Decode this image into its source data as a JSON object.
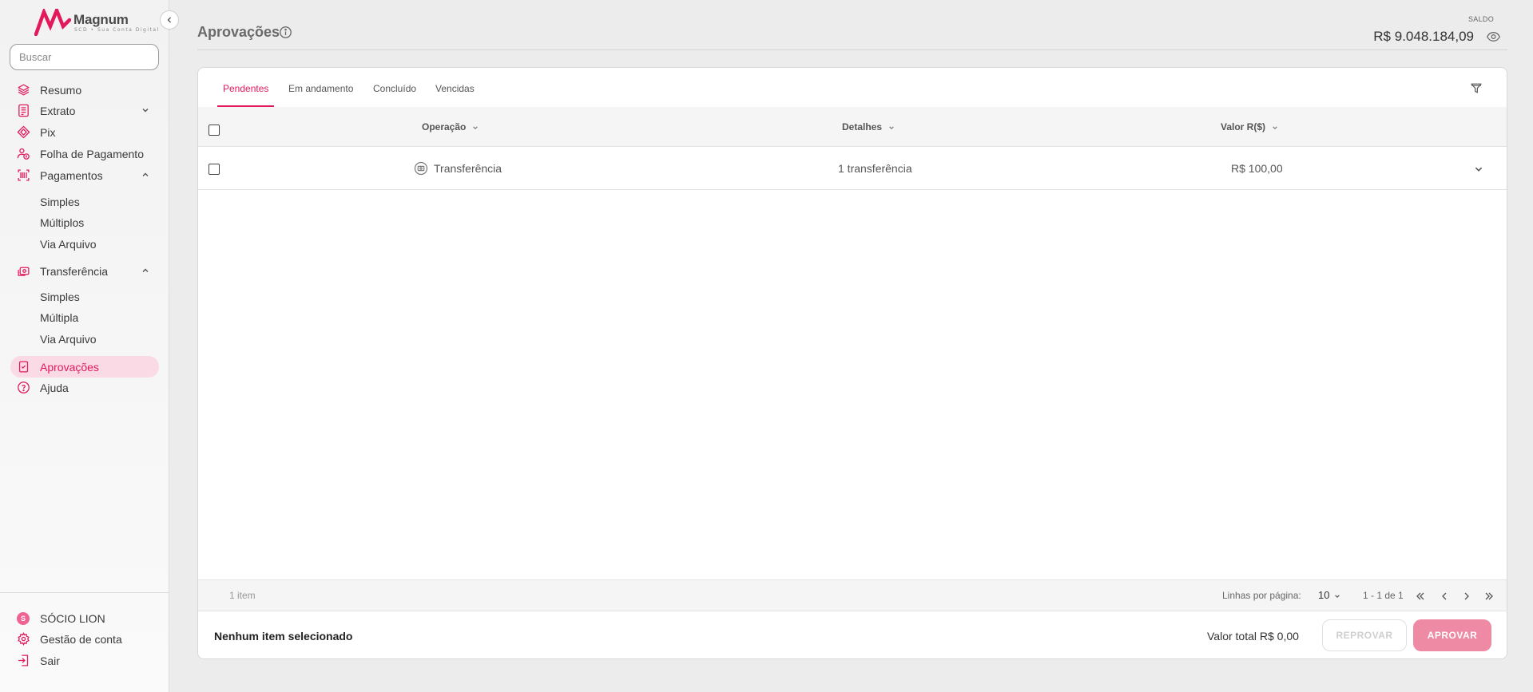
{
  "brand": {
    "name": "Magnum",
    "sub": "SCD • Sua Conta Digital",
    "color": "#e2195b"
  },
  "sidebar": {
    "search_placeholder": "Buscar",
    "items": [
      {
        "label": "Resumo",
        "icon": "layers-icon"
      },
      {
        "label": "Extrato",
        "icon": "document-list-icon"
      },
      {
        "label": "Pix",
        "icon": "pix-icon"
      },
      {
        "label": "Folha de Pagamento",
        "icon": "people-money-icon"
      },
      {
        "label": "Pagamentos",
        "icon": "barcode-icon"
      },
      {
        "label": "Transferência",
        "icon": "transfer-icon"
      },
      {
        "label": "Aprovações",
        "icon": "approval-doc-icon"
      },
      {
        "label": "Ajuda",
        "icon": "help-icon"
      }
    ],
    "pagamentos_sub": [
      "Simples",
      "Múltiplos",
      "Via Arquivo"
    ],
    "transferencia_sub": [
      "Simples",
      "Múltipla",
      "Via Arquivo"
    ],
    "user": {
      "initial": "S",
      "name": "SÓCIO LION"
    },
    "account_label": "Gestão de conta",
    "logout_label": "Sair"
  },
  "header": {
    "title": "Aprovações",
    "saldo_label": "SALDO",
    "saldo_value": "R$ 9.048.184,09"
  },
  "tabs": [
    "Pendentes",
    "Em andamento",
    "Concluído",
    "Vencidas"
  ],
  "table": {
    "columns": [
      "Operação",
      "Detalhes",
      "Valor R($)"
    ],
    "rows": [
      {
        "operacao": "Transferência",
        "detalhes": "1 transferência",
        "valor": "R$ 100,00"
      }
    ]
  },
  "footer": {
    "count": "1 item",
    "rows_label": "Linhas por página:",
    "rows_value": "10",
    "range": "1 - 1 de 1"
  },
  "actions": {
    "selection": "Nenhum item selecionado",
    "total": "Valor total R$ 0,00",
    "reprovar": "REPROVAR",
    "aprovar": "APROVAR"
  }
}
